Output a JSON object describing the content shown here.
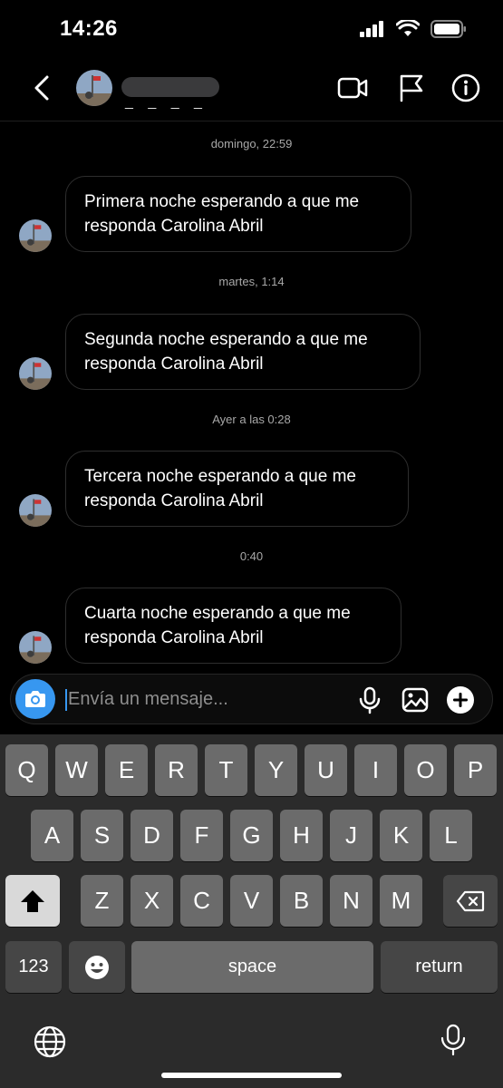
{
  "status_bar": {
    "time": "14:26"
  },
  "header": {
    "contact_name": "_ _ _ _"
  },
  "messages": [
    {
      "timestamp": "domingo, 22:59",
      "text": "Primera noche esperando a que me responda Carolina Abril"
    },
    {
      "timestamp": "martes, 1:14",
      "text": "Segunda noche esperando a que me responda Carolina Abril"
    },
    {
      "timestamp": "Ayer a las 0:28",
      "text": "Tercera noche esperando a que me responda Carolina Abril"
    },
    {
      "timestamp": "0:40",
      "text": "Cuarta noche esperando a que me responda Carolina Abril"
    }
  ],
  "composer": {
    "placeholder": "Envía un mensaje...",
    "value": ""
  },
  "keyboard": {
    "row1": [
      "Q",
      "W",
      "E",
      "R",
      "T",
      "Y",
      "U",
      "I",
      "O",
      "P"
    ],
    "row2": [
      "A",
      "S",
      "D",
      "F",
      "G",
      "H",
      "J",
      "K",
      "L"
    ],
    "row3": [
      "Z",
      "X",
      "C",
      "V",
      "B",
      "N",
      "M"
    ],
    "numbers_key": "123",
    "space_key": "space",
    "return_key": "return"
  },
  "colors": {
    "accent": "#3797f0",
    "bubble_border": "#2e2e2e",
    "keyboard_bg": "#2b2b2b"
  },
  "icons": {
    "header": [
      "chevron-left-icon",
      "video-call-icon",
      "flag-icon",
      "info-icon"
    ],
    "composer": [
      "camera-icon",
      "microphone-icon",
      "image-icon",
      "plus-circle-icon"
    ],
    "keyboard": [
      "shift-icon",
      "backspace-icon",
      "emoji-icon",
      "globe-icon",
      "dictation-icon"
    ]
  }
}
